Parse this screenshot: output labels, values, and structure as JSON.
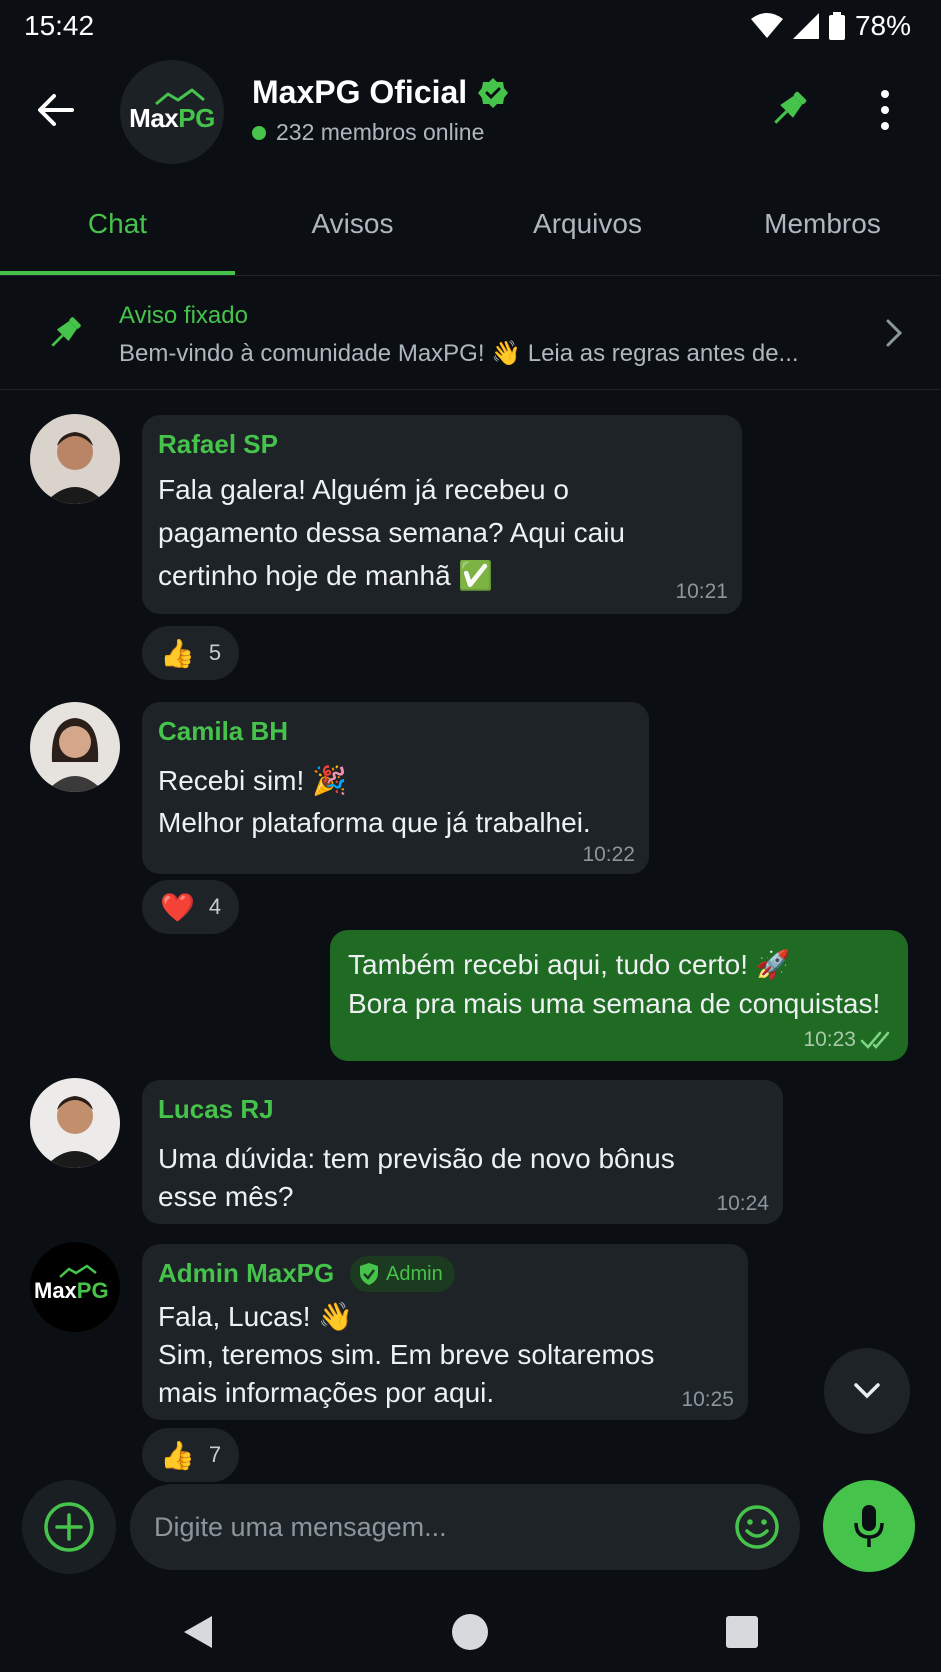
{
  "status_bar": {
    "time": "15:42",
    "battery": "78%"
  },
  "header": {
    "logo_max": "Max",
    "logo_pg": "PG",
    "title": "MaxPG Oficial",
    "online_text": "232 membros online"
  },
  "tabs": [
    {
      "label": "Chat"
    },
    {
      "label": "Avisos"
    },
    {
      "label": "Arquivos"
    },
    {
      "label": "Membros"
    }
  ],
  "pinned": {
    "title": "Aviso fixado",
    "text": "Bem-vindo à comunidade MaxPG! 👋 Leia as regras antes de..."
  },
  "messages": [
    {
      "sender": "Rafael SP",
      "lines": [
        "Fala galera! Alguém já recebeu o",
        "pagamento dessa semana? Aqui caiu",
        "certinho hoje de manhã ✅"
      ],
      "time": "10:21",
      "reaction": {
        "emoji": "👍",
        "count": "5"
      }
    },
    {
      "sender": "Camila BH",
      "lines": [
        "Recebi sim! 🎉",
        "Melhor plataforma que já trabalhei."
      ],
      "time": "10:22",
      "reaction": {
        "emoji": "❤️",
        "count": "4"
      }
    },
    {
      "outgoing": true,
      "lines": [
        "Também recebi aqui, tudo certo! 🚀",
        "Bora pra mais uma semana de conquistas!"
      ],
      "time": "10:23"
    },
    {
      "sender": "Lucas RJ",
      "lines": [
        "Uma dúvida: tem previsão de novo bônus",
        "esse mês?"
      ],
      "time": "10:24"
    },
    {
      "sender": "Admin MaxPG",
      "badge": "Admin",
      "lines": [
        "Fala, Lucas! 👋",
        "Sim, teremos sim. Em breve soltaremos",
        "mais informações por aqui."
      ],
      "time": "10:25",
      "reaction": {
        "emoji": "👍",
        "count": "7"
      }
    }
  ],
  "composer": {
    "placeholder": "Digite uma mensagem..."
  },
  "colors": {
    "accent": "#45c34a",
    "background": "#0b0f14",
    "bubble": "#1e2328",
    "outgoing_bubble": "#1f6b24"
  }
}
